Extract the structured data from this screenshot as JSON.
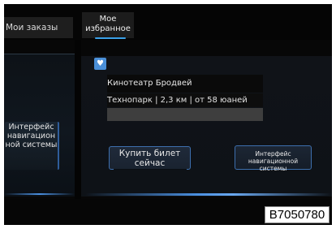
{
  "tabs": {
    "orders_label": "Мои заказы",
    "favorites_label": "Мое избранное"
  },
  "left_panel": {
    "nav_button_label": "Интерфейс навигацион ной системы"
  },
  "detail": {
    "heart_icon": "♥",
    "title": "Кинотеатр Бродвей",
    "info": "Технопарк | 2,3 км | от 58 юаней",
    "buy_button_label": "Купить билет сейчас",
    "nav_button_label": "Интерфейс навигационной системы"
  },
  "figure_code": "B7050780",
  "colors": {
    "accent": "#3aa0e8",
    "heart_badge": "#4a8fd8",
    "button_border": "#3d6fae"
  }
}
